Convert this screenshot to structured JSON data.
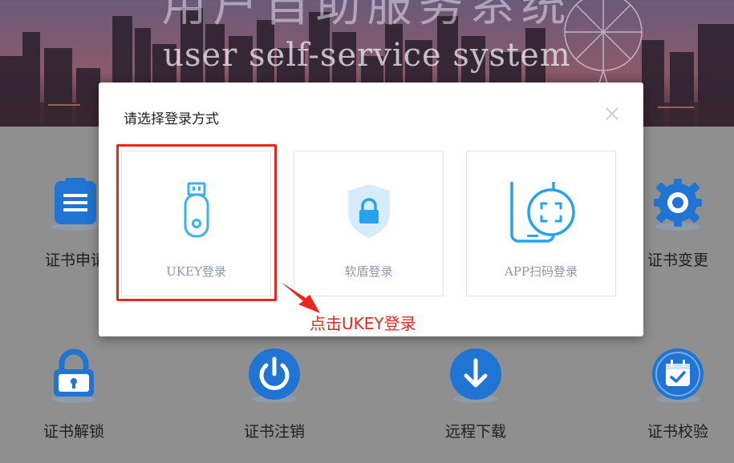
{
  "banner": {
    "title_cn": "用户自助服务系统",
    "title_en": "user self-service system"
  },
  "services": [
    {
      "label": "证书申请",
      "icon": "clipboard-icon"
    },
    {
      "label": "证书变更",
      "icon": "gear-icon"
    },
    {
      "label": "证书解锁",
      "icon": "padlock-icon"
    },
    {
      "label": "证书注销",
      "icon": "power-icon"
    },
    {
      "label": "远程下载",
      "icon": "download-icon"
    },
    {
      "label": "证书校验",
      "icon": "calendar-check-icon"
    }
  ],
  "modal": {
    "title": "请选择登录方式",
    "options": [
      {
        "label": "UKEY登录",
        "icon": "usb-key-icon"
      },
      {
        "label": "软盾登录",
        "icon": "shield-lock-icon"
      },
      {
        "label": "APP扫码登录",
        "icon": "phone-scan-icon"
      }
    ]
  },
  "annotation": {
    "text": "点击UKEY登录",
    "color": "#e8281f"
  },
  "colors": {
    "accent_blue": "#1f74d4",
    "light_blue": "#3cb0f0",
    "shield_bg": "#d7ecfa"
  }
}
